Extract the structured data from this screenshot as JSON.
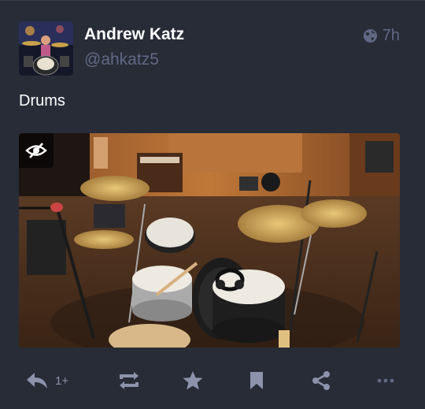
{
  "status": {
    "account": {
      "display_name": "Andrew Katz",
      "handle": "@ahkatz5",
      "avatar": "drummer-photo"
    },
    "visibility_icon": "globe-icon",
    "timestamp": "7h",
    "content": "Drums",
    "media": {
      "type": "image",
      "subject": "drum kit in recording studio",
      "hide_button_icon": "eye-slash-icon"
    },
    "actions": {
      "reply_icon": "reply-icon",
      "reply_count": "1+",
      "boost_icon": "retweet-icon",
      "favourite_icon": "star-icon",
      "bookmark_icon": "bookmark-icon",
      "share_icon": "share-icon",
      "more_icon": "ellipsis-icon"
    }
  },
  "colors": {
    "background": "#282c37",
    "primary_text": "#ffffff",
    "secondary_text": "#606984",
    "action_icon": "#8c93ab"
  }
}
